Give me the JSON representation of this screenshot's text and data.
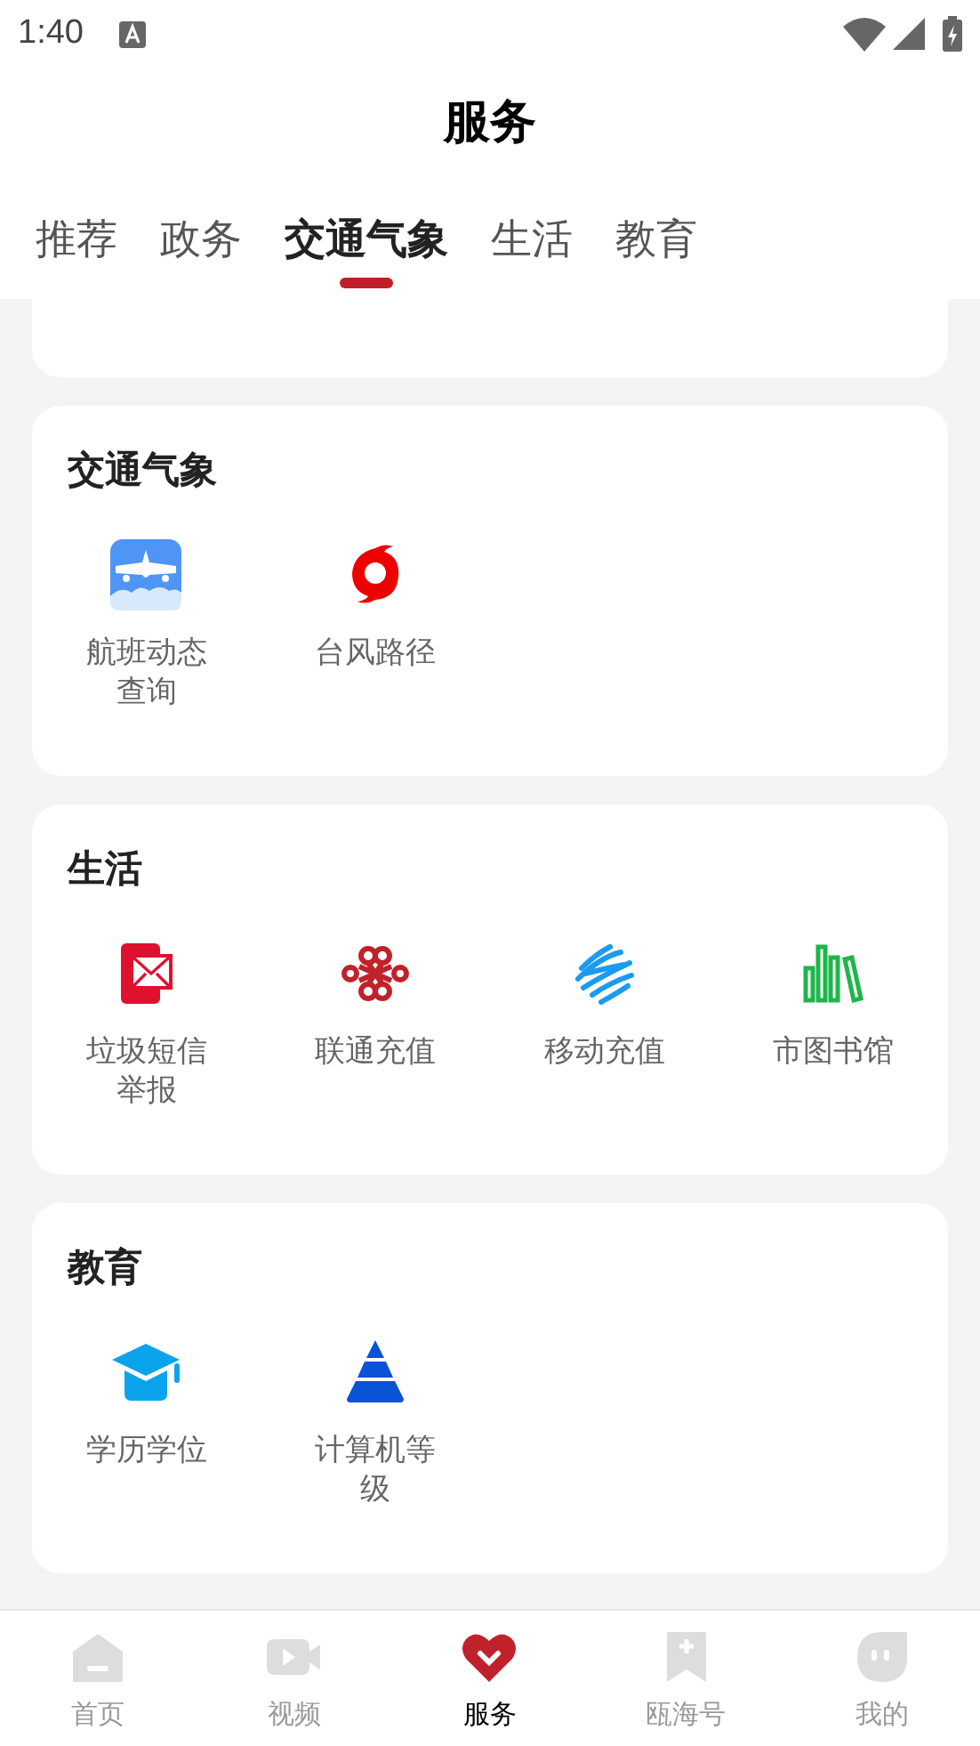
{
  "status_bar": {
    "time": "1:40"
  },
  "header": {
    "title": "服务"
  },
  "tabs": [
    {
      "label": "推荐",
      "selected": false
    },
    {
      "label": "政务",
      "selected": false
    },
    {
      "label": "交通气象",
      "selected": true
    },
    {
      "label": "生活",
      "selected": false
    },
    {
      "label": "教育",
      "selected": false
    }
  ],
  "sections": [
    {
      "title": "交通气象",
      "items": [
        {
          "label": "航班动态查询",
          "kind": "plane"
        },
        {
          "label": "台风路径",
          "kind": "typhoon"
        }
      ]
    },
    {
      "title": "生活",
      "items": [
        {
          "label": "垃圾短信举报",
          "kind": "sms"
        },
        {
          "label": "联通充值",
          "kind": "knot"
        },
        {
          "label": "移动充值",
          "kind": "waves"
        },
        {
          "label": "市图书馆",
          "kind": "books"
        }
      ]
    },
    {
      "title": "教育",
      "items": [
        {
          "label": "学历学位",
          "kind": "cap"
        },
        {
          "label": "计算机等级",
          "kind": "pyramid"
        }
      ]
    }
  ],
  "bottom_nav": [
    {
      "label": "首页",
      "kind": "home",
      "selected": false
    },
    {
      "label": "视频",
      "kind": "video",
      "selected": false
    },
    {
      "label": "服务",
      "kind": "heart",
      "selected": true
    },
    {
      "label": "瓯海号",
      "kind": "bookmark",
      "selected": false
    },
    {
      "label": "我的",
      "kind": "face",
      "selected": false
    }
  ]
}
